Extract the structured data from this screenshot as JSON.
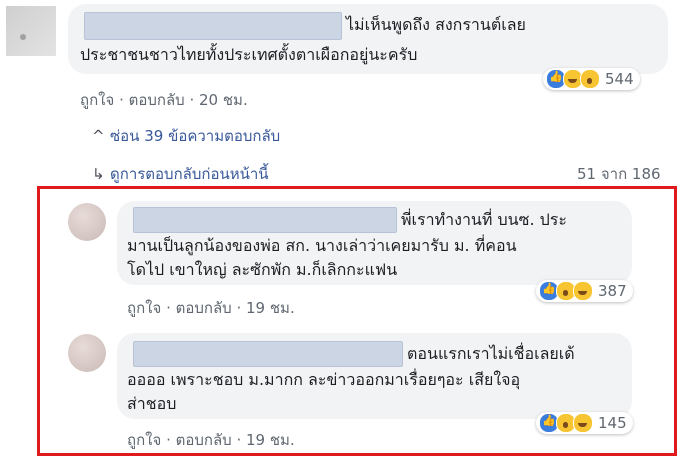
{
  "main_comment": {
    "text_line1": "ไม่เห็นพูดถึง สงกรานต์เลย",
    "text_line2": "ประชาชนชาวไทยทั้งประเทศตั้งตาเผือกอยู่นะครับ",
    "like_label": "ถูกใจ",
    "reply_label": "ตอบกลับ",
    "time": "20 ชม.",
    "reaction_count": "544",
    "reactions": [
      "like-icon",
      "haha-icon",
      "wow-icon"
    ]
  },
  "replies_controls": {
    "hide_label": "ซ่อน 39 ข้อความตอบกลับ",
    "hide_icon": "chevron-up-icon",
    "previous_label": "ดูการตอบกลับก่อนหน้านี้",
    "previous_icon": "reply-arrow-icon",
    "pager": "51 จาก 186"
  },
  "replies": [
    {
      "lines": [
        "พี่เราทำงานที่ บนซ. ประ",
        "มานเป็นลูกน้องของพ่อ สก. นางเล่าว่าเคยมารับ ม. ที่คอน",
        "โดไป เขาใหญ่ ละซักพัก ม.ก็เลิกกะแฟน"
      ],
      "like_label": "ถูกใจ",
      "reply_label": "ตอบกลับ",
      "time": "19 ชม.",
      "reaction_count": "387",
      "reactions": [
        "like-icon",
        "wow-icon",
        "haha-icon"
      ]
    },
    {
      "lines": [
        "ตอนแรกเราไม่เชื่อเลยเด้",
        "ออออ เพราะชอบ ม.มากก ละข่าวออกมาเรื่อยๆอะ เสียใจอุ",
        "ส่าชอบ"
      ],
      "like_label": "ถูกใจ",
      "reply_label": "ตอบกลับ",
      "time": "19 ชม.",
      "reaction_count": "145",
      "reactions": [
        "like-icon",
        "wow-icon",
        "haha-icon"
      ]
    }
  ],
  "colors": {
    "highlight": "#e0191c",
    "link": "#385898",
    "bubble": "#f2f3f5"
  }
}
